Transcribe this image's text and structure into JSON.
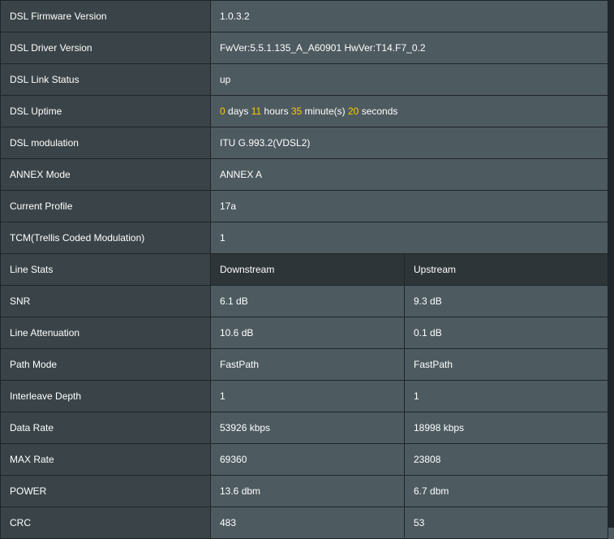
{
  "info_rows": [
    {
      "label": "DSL Firmware Version",
      "value": "1.0.3.2"
    },
    {
      "label": "DSL Driver Version",
      "value": "FwVer:5.5.1.135_A_A60901 HwVer:T14.F7_0.2"
    },
    {
      "label": "DSL Link Status",
      "value": "up"
    }
  ],
  "uptime": {
    "label": "DSL Uptime",
    "days": "0",
    "days_unit": "days",
    "hours": "11",
    "hours_unit": "hours",
    "minutes": "35",
    "minutes_unit": "minute(s)",
    "seconds": "20",
    "seconds_unit": "seconds"
  },
  "info_rows2": [
    {
      "label": "DSL modulation",
      "value": "ITU G.993.2(VDSL2)"
    },
    {
      "label": "ANNEX Mode",
      "value": "ANNEX A"
    },
    {
      "label": "Current Profile",
      "value": "17a"
    },
    {
      "label": "TCM(Trellis Coded Modulation)",
      "value": "1"
    }
  ],
  "line_stats": {
    "header": {
      "label": "Line Stats",
      "downstream": "Downstream",
      "upstream": "Upstream"
    },
    "rows": [
      {
        "label": "SNR",
        "down": "6.1 dB",
        "up": "9.3 dB"
      },
      {
        "label": "Line Attenuation",
        "down": "10.6 dB",
        "up": "0.1 dB"
      },
      {
        "label": "Path Mode",
        "down": "FastPath",
        "up": "FastPath"
      },
      {
        "label": "Interleave Depth",
        "down": "1",
        "up": "1"
      },
      {
        "label": "Data Rate",
        "down": "53926 kbps",
        "up": "18998 kbps"
      },
      {
        "label": "MAX Rate",
        "down": "69360",
        "up": "23808"
      },
      {
        "label": "POWER",
        "down": "13.6 dbm",
        "up": "6.7 dbm"
      },
      {
        "label": "CRC",
        "down": "483",
        "up": "53"
      }
    ]
  },
  "colors": {
    "label_bg": "#3a4448",
    "value_bg": "#4d5a60",
    "header_bg": "#2e3538",
    "highlight_number": "#ffcc00",
    "border": "#1f2528"
  }
}
